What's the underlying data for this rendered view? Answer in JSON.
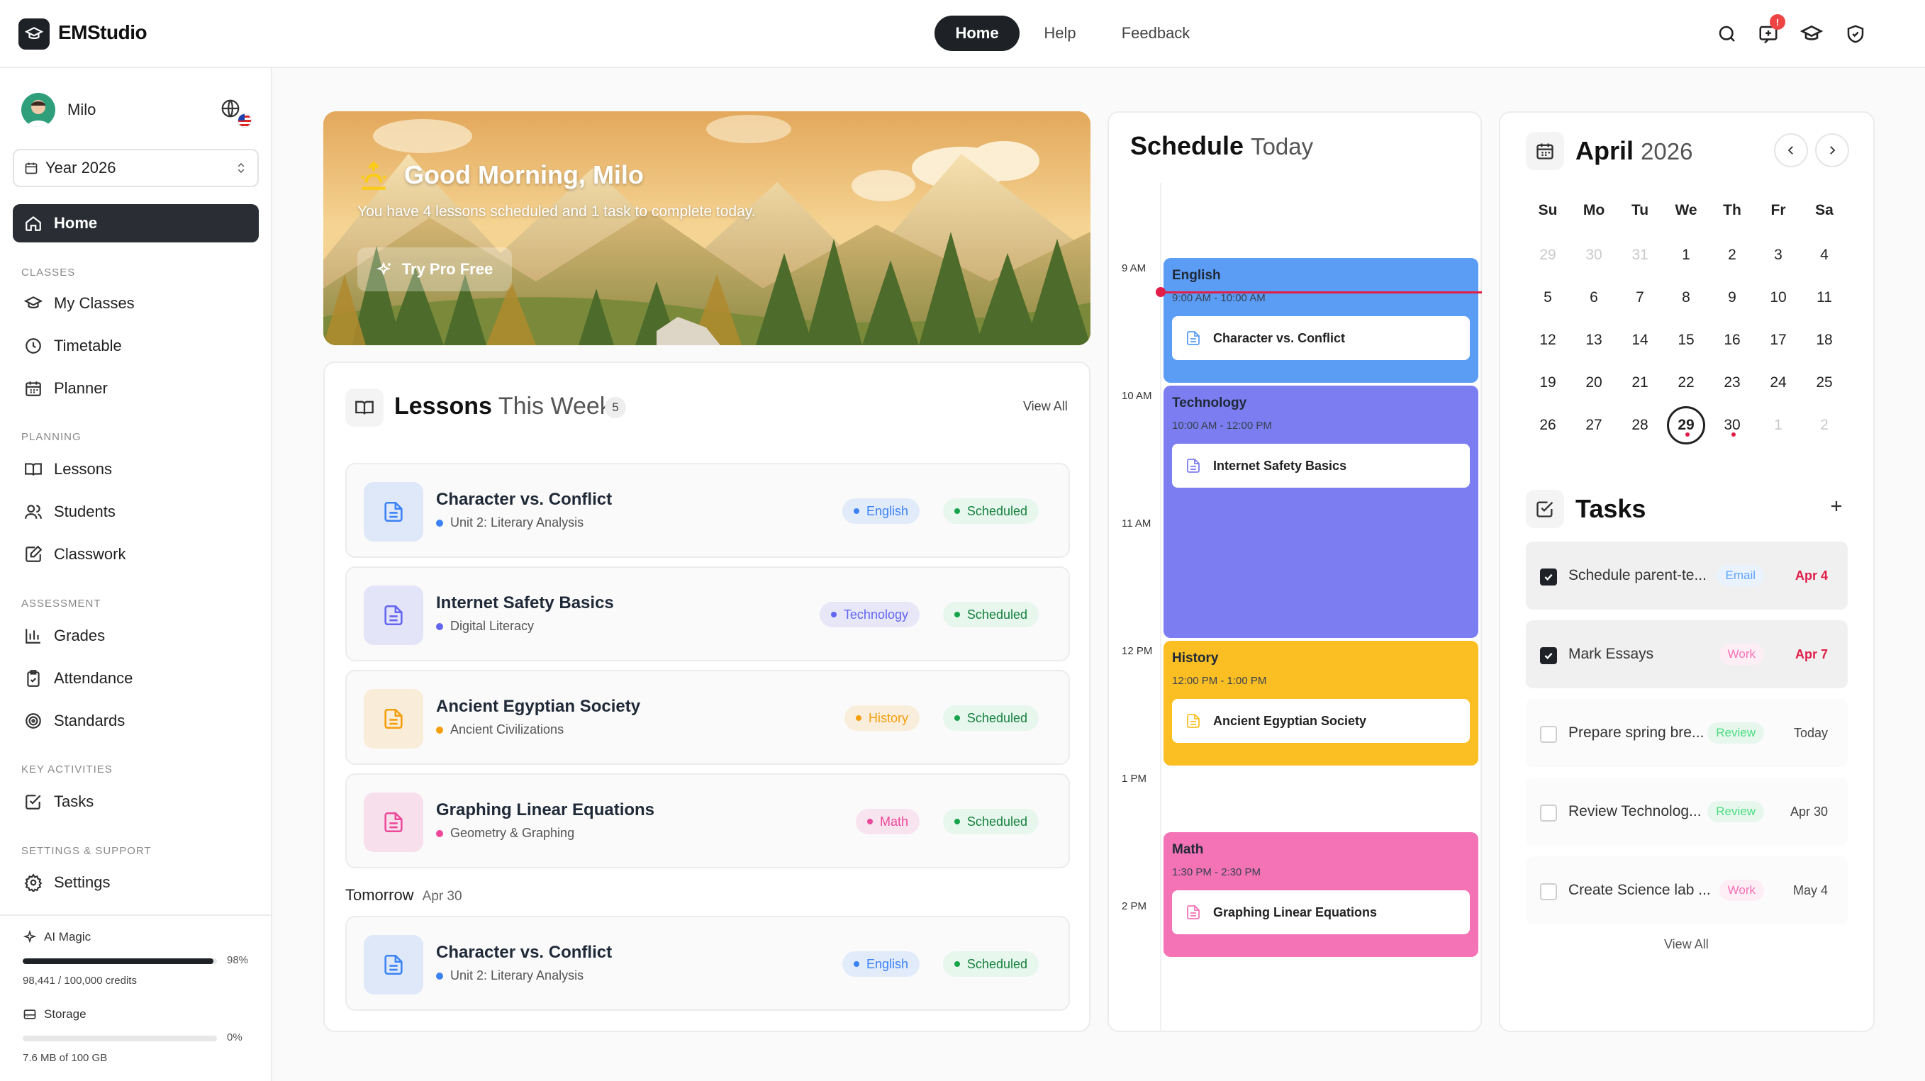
{
  "app": {
    "name": "EMStudio"
  },
  "topnav": {
    "home": "Home",
    "help": "Help",
    "feedback": "Feedback",
    "notification_count": "!"
  },
  "user": {
    "name": "Milo"
  },
  "year_select": {
    "value": "Year 2026"
  },
  "sidebar": {
    "home": "Home",
    "sections": {
      "classes": "CLASSES",
      "planning": "PLANNING",
      "assessment": "ASSESSMENT",
      "key": "KEY ACTIVITIES",
      "settings": "SETTINGS & SUPPORT"
    },
    "items": {
      "my_classes": "My Classes",
      "timetable": "Timetable",
      "planner": "Planner",
      "lessons": "Lessons",
      "students": "Students",
      "classwork": "Classwork",
      "grades": "Grades",
      "attendance": "Attendance",
      "standards": "Standards",
      "tasks": "Tasks",
      "settings": "Settings"
    },
    "ai": {
      "label": "AI Magic",
      "percent": "98%",
      "fraction": 0.98,
      "credits": "98,441 / 100,000 credits"
    },
    "storage": {
      "label": "Storage",
      "percent": "0%",
      "fraction": 0.0,
      "usage": "7.6 MB of 100 GB"
    }
  },
  "hero": {
    "title": "Good Morning, Milo",
    "subtitle": "You have 4 lessons scheduled and 1 task to complete today.",
    "button": "Try Pro Free"
  },
  "lessons": {
    "title": "Lessons",
    "title_suffix": "This Week",
    "count": "5",
    "view_all": "View All",
    "items": [
      {
        "title": "Character vs. Conflict",
        "unit": "Unit 2: Literary Analysis",
        "subject": "English",
        "status": "Scheduled",
        "color": "#3b82f6"
      },
      {
        "title": "Internet Safety Basics",
        "unit": "Digital Literacy",
        "subject": "Technology",
        "status": "Scheduled",
        "color": "#6366f1"
      },
      {
        "title": "Ancient Egyptian Society",
        "unit": "Ancient Civilizations",
        "subject": "History",
        "status": "Scheduled",
        "color": "#f59e0b"
      },
      {
        "title": "Graphing Linear Equations",
        "unit": "Geometry & Graphing",
        "subject": "Math",
        "status": "Scheduled",
        "color": "#ec4899"
      }
    ],
    "tomorrow": {
      "label": "Tomorrow",
      "date": "Apr 30"
    },
    "tomorrow_items": [
      {
        "title": "Character vs. Conflict",
        "unit": "Unit 2: Literary Analysis",
        "subject": "English",
        "status": "Scheduled",
        "color": "#3b82f6"
      }
    ]
  },
  "schedule": {
    "title": "Schedule",
    "title_suffix": "Today",
    "hours": [
      "9 AM",
      "10 AM",
      "11 AM",
      "12 PM",
      "1 PM",
      "2 PM"
    ],
    "events": [
      {
        "subject": "English",
        "time": "9:00 AM - 10:00 AM",
        "lesson": "Character vs. Conflict",
        "color": "#5b9cf5"
      },
      {
        "subject": "Technology",
        "time": "10:00 AM - 12:00 PM",
        "lesson": "Internet Safety Basics",
        "color": "#7c7df0"
      },
      {
        "subject": "History",
        "time": "12:00 PM - 1:00 PM",
        "lesson": "Ancient Egyptian Society",
        "color": "#fbbf24"
      },
      {
        "subject": "Math",
        "time": "1:30 PM - 2:30 PM",
        "lesson": "Graphing Linear Equations",
        "color": "#f472b6"
      }
    ]
  },
  "calendar": {
    "month": "April",
    "year": "2026",
    "weekdays": [
      "Su",
      "Mo",
      "Tu",
      "We",
      "Th",
      "Fr",
      "Sa"
    ],
    "weeks": [
      [
        "29",
        "30",
        "31",
        "1",
        "2",
        "3",
        "4"
      ],
      [
        "5",
        "6",
        "7",
        "8",
        "9",
        "10",
        "11"
      ],
      [
        "12",
        "13",
        "14",
        "15",
        "16",
        "17",
        "18"
      ],
      [
        "19",
        "20",
        "21",
        "22",
        "23",
        "24",
        "25"
      ],
      [
        "26",
        "27",
        "28",
        "29",
        "30",
        "1",
        "2"
      ]
    ],
    "today": "29"
  },
  "tasks": {
    "title": "Tasks",
    "view_all": "View All",
    "items": [
      {
        "text": "Schedule parent-te...",
        "tag": "Email",
        "date": "Apr 4",
        "done": true
      },
      {
        "text": "Mark Essays",
        "tag": "Work",
        "date": "Apr 7",
        "done": true
      },
      {
        "text": "Prepare spring bre...",
        "tag": "Review",
        "date": "Today",
        "done": false
      },
      {
        "text": "Review Technolog...",
        "tag": "Review",
        "date": "Apr 30",
        "done": false
      },
      {
        "text": "Create Science lab ...",
        "tag": "Work",
        "date": "May 4",
        "done": false
      }
    ]
  }
}
